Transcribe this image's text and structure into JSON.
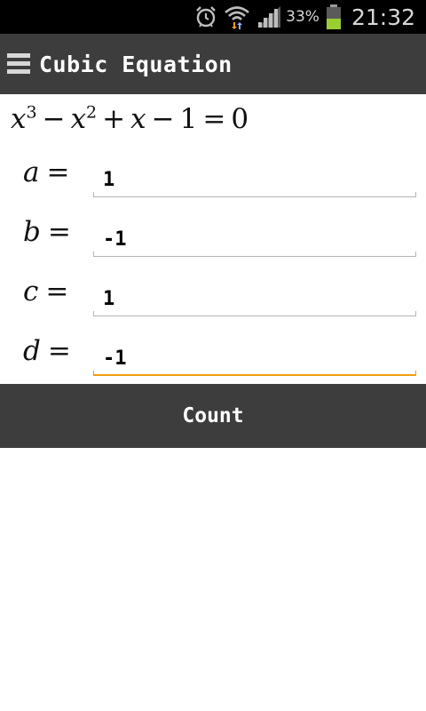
{
  "status_bar": {
    "battery_percent": "33%",
    "time": "21:32",
    "icons": [
      "alarm-icon",
      "wifi-icon",
      "signal-icon",
      "battery-icon"
    ],
    "battery_color": "#9acd32"
  },
  "action_bar": {
    "title": "Cubic Equation",
    "background": "#3d3d3d"
  },
  "equation": {
    "x": "x",
    "exp3": "3",
    "minus1": "−",
    "exp2": "2",
    "plus": "+",
    "minus2": "−",
    "one": "1",
    "equals": "=",
    "zero": "0"
  },
  "coefficients": [
    {
      "label": "a",
      "eq": "=",
      "value": "1"
    },
    {
      "label": "b",
      "eq": "=",
      "value": "-1"
    },
    {
      "label": "c",
      "eq": "=",
      "value": "1"
    },
    {
      "label": "d",
      "eq": "=",
      "value": "-1"
    }
  ],
  "count_button": {
    "label": "Count"
  },
  "colors": {
    "focus_accent": "#f39c12",
    "underline": "#b5b5b5"
  }
}
